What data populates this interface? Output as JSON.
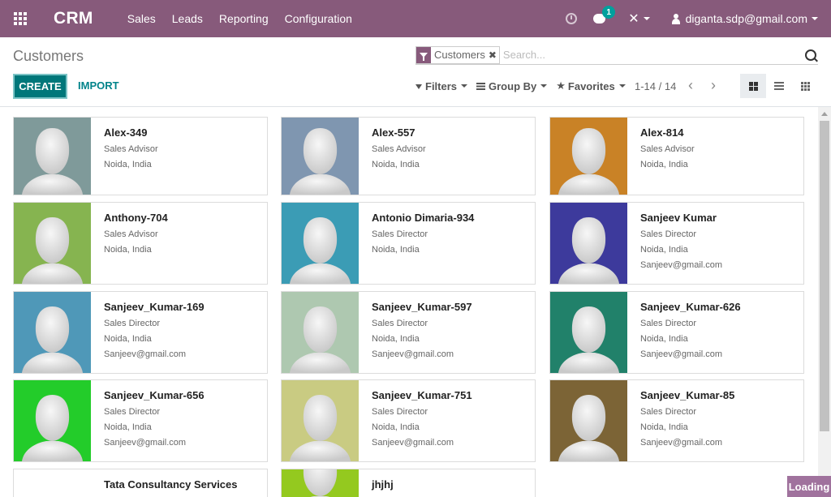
{
  "navbar": {
    "brand": "CRM",
    "menu": [
      "Sales",
      "Leads",
      "Reporting",
      "Configuration"
    ],
    "chat_badge": "1",
    "user_email": "diganta.sdp@gmail.com"
  },
  "control": {
    "breadcrumb": "Customers",
    "facet_label": "Customers",
    "facet_remove": "✖",
    "search_placeholder": "Search...",
    "create_label": "CREATE",
    "import_label": "IMPORT",
    "filters_label": "Filters",
    "groupby_label": "Group By",
    "favorites_label": "Favorites",
    "pager": "1-14 / 14",
    "pager_prev": "‹",
    "pager_next": "›"
  },
  "cards": [
    {
      "name": "Alex-349",
      "title": "Sales Advisor",
      "location": "Noida, India",
      "email": "",
      "color": "#7f9a9a"
    },
    {
      "name": "Alex-557",
      "title": "Sales Advisor",
      "location": "Noida, India",
      "email": "",
      "color": "#7f96b0"
    },
    {
      "name": "Alex-814",
      "title": "Sales Advisor",
      "location": "Noida, India",
      "email": "",
      "color": "#c98226"
    },
    {
      "name": "Anthony-704",
      "title": "Sales Advisor",
      "location": "Noida, India",
      "email": "",
      "color": "#86b450"
    },
    {
      "name": "Antonio Dimaria-934",
      "title": "Sales Director",
      "location": "Noida, India",
      "email": "",
      "color": "#3b9cb5"
    },
    {
      "name": "Sanjeev Kumar",
      "title": "Sales Director",
      "location": "Noida, India",
      "email": "Sanjeev@gmail.com",
      "color": "#3d3a9c"
    },
    {
      "name": "Sanjeev_Kumar-169",
      "title": "Sales Director",
      "location": "Noida, India",
      "email": "Sanjeev@gmail.com",
      "color": "#4f98b8"
    },
    {
      "name": "Sanjeev_Kumar-597",
      "title": "Sales Director",
      "location": "Noida, India",
      "email": "Sanjeev@gmail.com",
      "color": "#aec8b0"
    },
    {
      "name": "Sanjeev_Kumar-626",
      "title": "Sales Director",
      "location": "Noida, India",
      "email": "Sanjeev@gmail.com",
      "color": "#21816a"
    },
    {
      "name": "Sanjeev_Kumar-656",
      "title": "Sales Director",
      "location": "Noida, India",
      "email": "Sanjeev@gmail.com",
      "color": "#23cc2a"
    },
    {
      "name": "Sanjeev_Kumar-751",
      "title": "Sales Director",
      "location": "Noida, India",
      "email": "Sanjeev@gmail.com",
      "color": "#c9cb82"
    },
    {
      "name": "Sanjeev_Kumar-85",
      "title": "Sales Director",
      "location": "Noida, India",
      "email": "Sanjeev@gmail.com",
      "color": "#7c6436"
    },
    {
      "name": "Tata Consultancy Services",
      "title": "",
      "location": "",
      "email": "",
      "color": "#ffffff"
    },
    {
      "name": "jhjhj",
      "title": "",
      "location": "",
      "email": "",
      "color": "#94c91f"
    }
  ],
  "loading_label": "Loading"
}
